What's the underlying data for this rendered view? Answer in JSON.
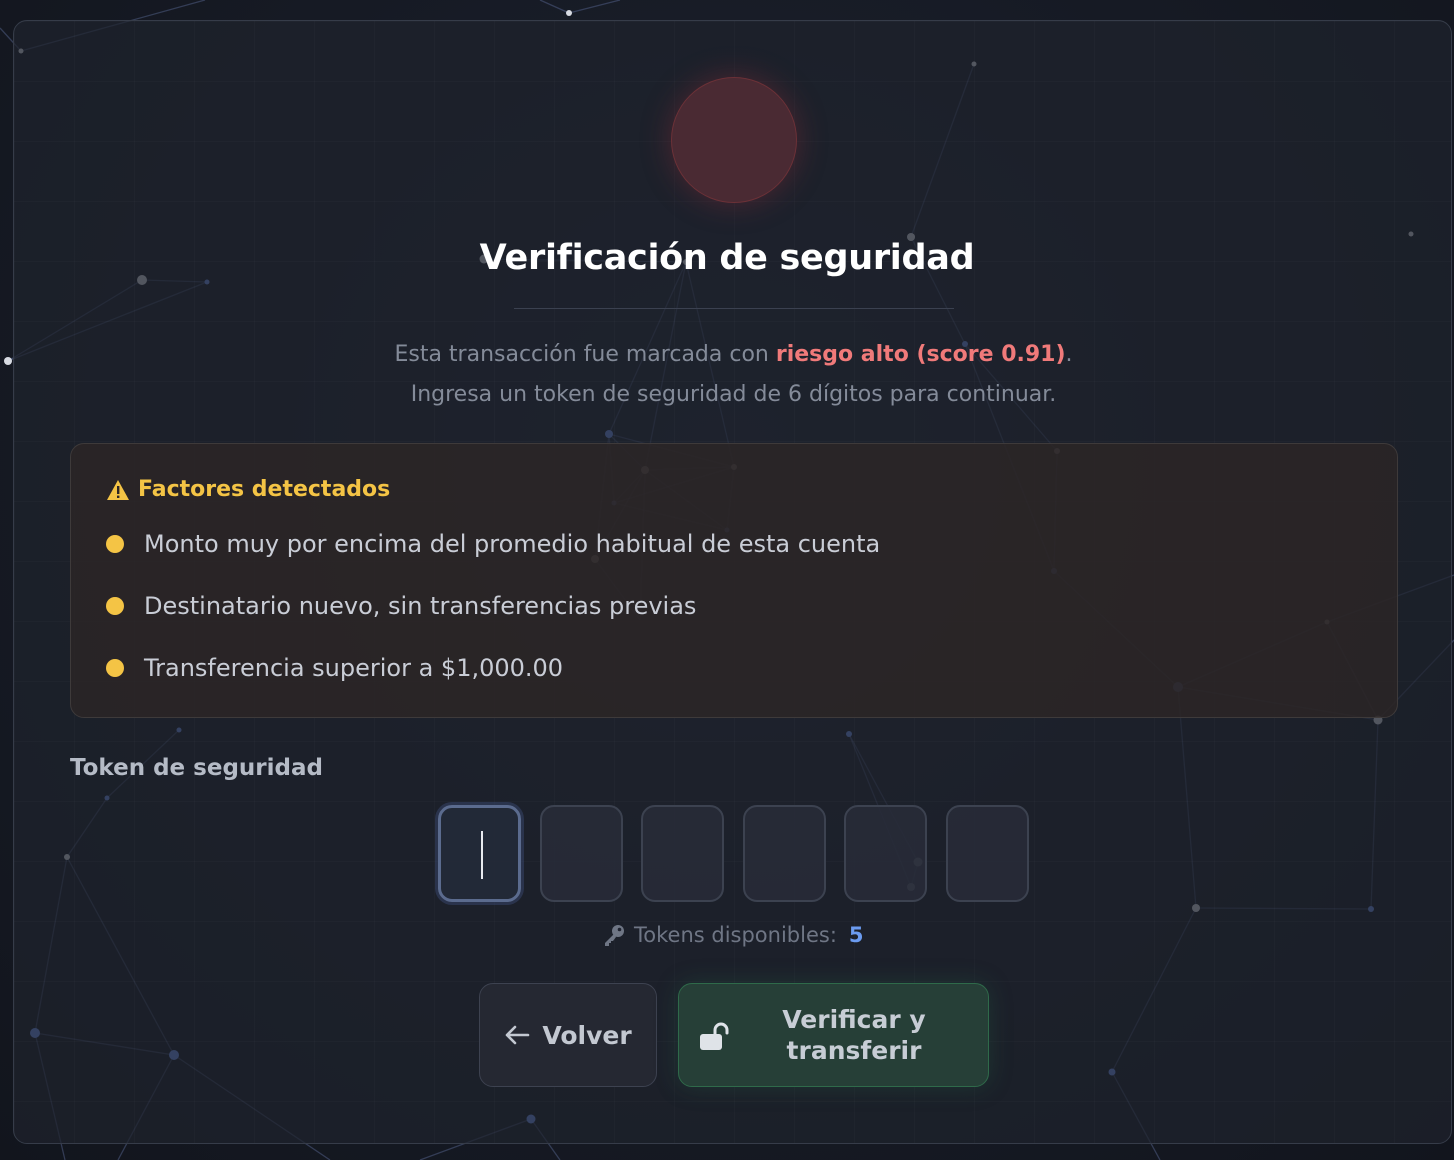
{
  "dialog": {
    "title": "Verificación de seguridad",
    "description_prefix": "Esta transacción fue marcada con ",
    "risk_text": "riesgo alto (score 0.91)",
    "description_suffix": ".",
    "description_line2": "Ingresa un token de seguridad de 6 dígitos para continuar."
  },
  "factors": {
    "heading": "Factores detectados",
    "items": [
      "Monto muy por encima del promedio habitual de esta cuenta",
      "Destinatario nuevo, sin transferencias previas",
      "Transferencia superior a $1,000.00"
    ]
  },
  "token": {
    "label": "Token de seguridad",
    "digits": [
      "",
      "",
      "",
      "",
      "",
      ""
    ],
    "available_label": "Tokens disponibles:",
    "available_count": "5"
  },
  "actions": {
    "back_label": "Volver",
    "verify_label_line1": "Verificar y",
    "verify_label_line2": "transferir"
  },
  "colors": {
    "risk": "#f07a7a",
    "warning": "#f4c445",
    "accent_count": "#6b9bf0",
    "verify_bg": "#263f37"
  },
  "icons": {
    "warning": "warning-triangle-icon",
    "key": "key-icon",
    "back": "arrow-left-icon",
    "unlock": "unlock-icon"
  }
}
